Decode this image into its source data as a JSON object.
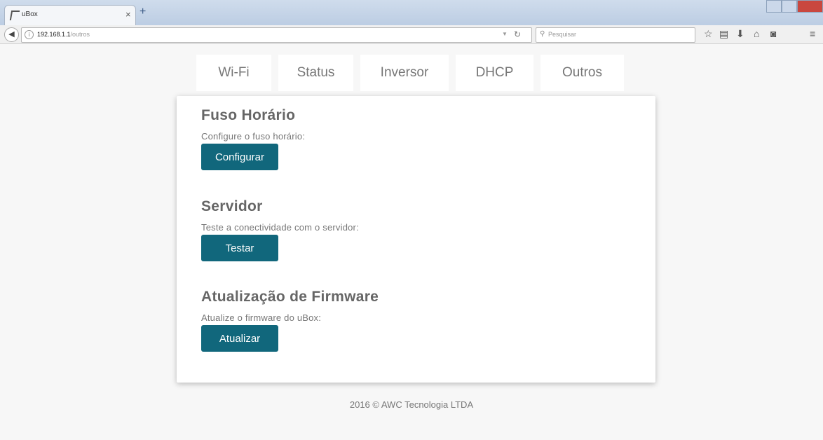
{
  "browser": {
    "tab_title": "uBox",
    "tab_close": "×",
    "new_tab": "+",
    "url_host": "192.168.1.1",
    "url_path": "/outros",
    "search_placeholder": "Pesquisar",
    "icons": [
      "back-icon",
      "info-icon",
      "reload-icon",
      "search-icon",
      "bookmark-star-icon",
      "library-icon",
      "download-icon",
      "home-icon",
      "pocket-icon",
      "menu-icon"
    ]
  },
  "nav": {
    "tabs": [
      {
        "label": "Wi-Fi"
      },
      {
        "label": "Status"
      },
      {
        "label": "Inversor"
      },
      {
        "label": "DHCP"
      },
      {
        "label": "Outros"
      }
    ]
  },
  "sections": [
    {
      "title": "Fuso Horário",
      "description": "Configure o fuso horário:",
      "button": "Configurar"
    },
    {
      "title": "Servidor",
      "description": "Teste a conectividade com o servidor:",
      "button": "Testar"
    },
    {
      "title": "Atualização de Firmware",
      "description": "Atualize o firmware do uBox:",
      "button": "Atualizar"
    }
  ],
  "footer": "2016 © AWC Tecnologia LTDA",
  "colors": {
    "button": "#11677c",
    "background": "#f7f7f7",
    "card": "#ffffff"
  }
}
